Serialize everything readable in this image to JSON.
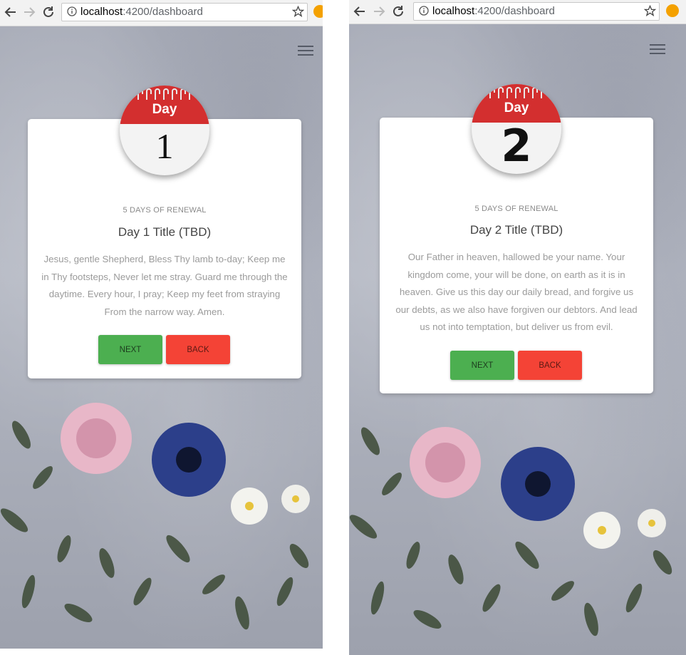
{
  "screens": [
    {
      "url_host": "localhost",
      "url_path": ":4200/dashboard",
      "calendar_label": "Day",
      "day_number": "1",
      "kicker": "5 DAYS OF RENEWAL",
      "title": "Day 1 Title (TBD)",
      "body": "Jesus, gentle Shepherd, Bless Thy lamb to-day; Keep me in Thy footsteps, Never let me stray. Guard me through the daytime. Every hour, I pray; Keep my feet from straying From the narrow way. Amen.",
      "next_label": "NEXT",
      "back_label": "BACK"
    },
    {
      "url_host": "localhost",
      "url_path": ":4200/dashboard",
      "calendar_label": "Day",
      "day_number": "2",
      "kicker": "5 DAYS OF RENEWAL",
      "title": "Day 2 Title (TBD)",
      "body": "Our Father in heaven, hallowed be your name. Your kingdom come, your will be done, on earth as it is in heaven. Give us this day our daily bread, and forgive us our debts, as we also have forgiven our debtors. And lead us not into temptation, but deliver us from evil.",
      "next_label": "NEXT",
      "back_label": "BACK"
    }
  ],
  "colors": {
    "next": "#4caf50",
    "back": "#f44336",
    "calendar_red": "#d32f2f"
  },
  "icons": [
    "back-arrow-icon",
    "forward-arrow-icon",
    "reload-icon",
    "info-icon",
    "star-icon",
    "extension-icon",
    "hamburger-menu-icon"
  ]
}
